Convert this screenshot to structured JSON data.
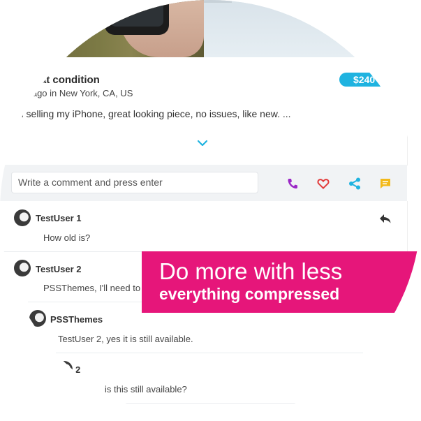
{
  "listing": {
    "title": "e great condition",
    "subtitle": "eks ago in New York, CA, US",
    "price": "$240",
    "description": "m selling my iPhone, great looking piece, no issues, like new. ..."
  },
  "comment_bar": {
    "placeholder": "Write a comment and press enter"
  },
  "actions": [
    {
      "icon": "phone-icon",
      "color": "#9b27c6"
    },
    {
      "icon": "heart-icon",
      "color": "#e23b3b"
    },
    {
      "icon": "share-icon",
      "color": "#1fb3e0"
    },
    {
      "icon": "chat-icon",
      "color": "#f2b91a"
    }
  ],
  "comments": [
    {
      "user": "TestUser 1",
      "text": "How old is?"
    },
    {
      "user": "TestUser 2",
      "text": "PSSThemes, I'll need to s"
    },
    {
      "user": "PSSThemes",
      "text": "TestUser 2, yes it is still available."
    },
    {
      "user": "2",
      "text": "is this still available?"
    }
  ],
  "promo": {
    "headline": "Do more with less",
    "subline": "everything compressed",
    "color": "#e6167a"
  }
}
